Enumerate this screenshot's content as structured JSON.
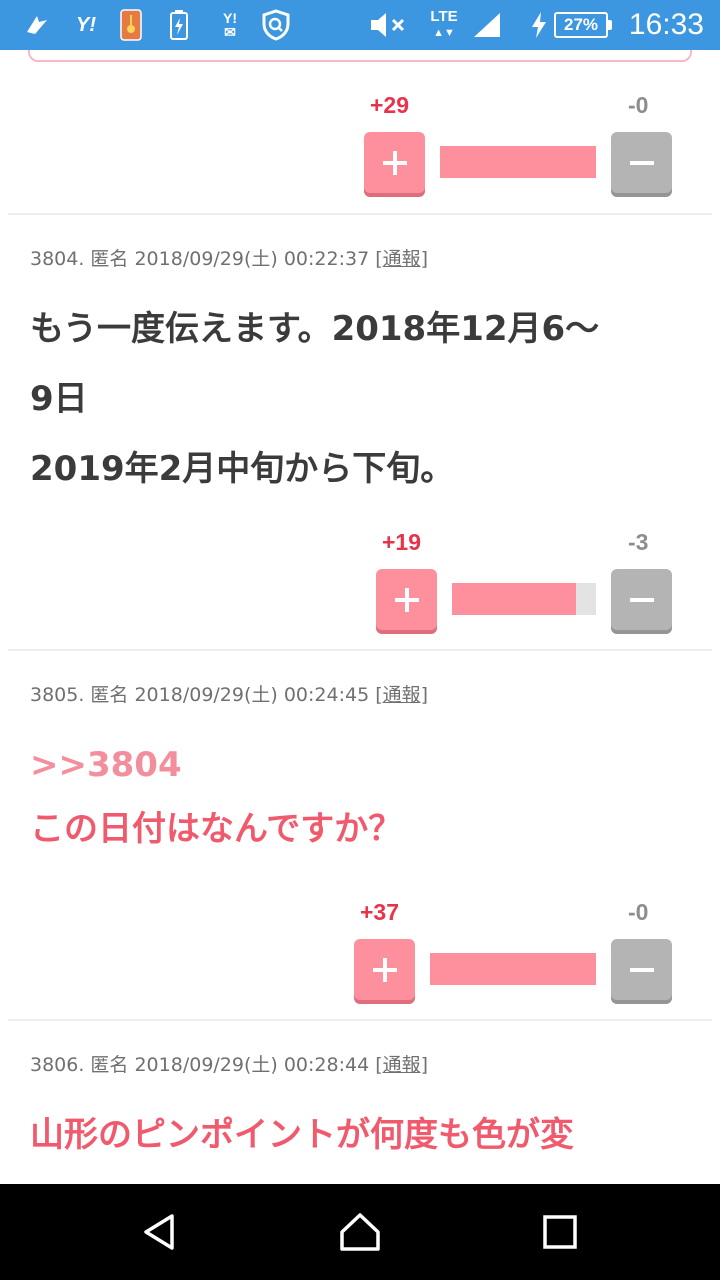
{
  "status_bar": {
    "time": "16:33",
    "battery": "27%",
    "network": "LTE",
    "icons": [
      "notification-icon",
      "yahoo-icon",
      "app-icon",
      "battery-saver-icon",
      "yahoo-mail-icon",
      "security-shield-icon",
      "mute-icon",
      "lte-icon",
      "signal-icon",
      "charging-icon",
      "battery-icon"
    ]
  },
  "comments": [
    {
      "number": "",
      "meta": "",
      "report": "",
      "text_lines": [],
      "votes": {
        "plus": "+29",
        "minus": "-0",
        "ratio": 1.0
      }
    },
    {
      "number": "3804.",
      "meta": "3804. 匿名 2018/09/29(土) 00:22:37",
      "report": "[通報]",
      "text_lines": [
        "もう一度伝えます。2018年12月6〜",
        "9日",
        "2019年2月中旬から下旬。"
      ],
      "votes": {
        "plus": "+19",
        "minus": "-3",
        "ratio": 0.86
      }
    },
    {
      "number": "3805.",
      "meta": "3805. 匿名 2018/09/29(土) 00:24:45",
      "report": "[通報]",
      "anchor": ">>3804",
      "text_lines": [
        "この日付はなんですか？"
      ],
      "votes": {
        "plus": "+37",
        "minus": "-0",
        "ratio": 1.0
      }
    },
    {
      "number": "3806.",
      "meta": "3806. 匿名 2018/09/29(土) 00:28:44",
      "report": "[通報]",
      "text_lines": [
        "山形のピンポイントが何度も色が変"
      ]
    }
  ],
  "colors": {
    "status_bar": "#3d96e0",
    "plus": "#fe8f9c",
    "plus_count": "#e8334a",
    "minus": "#b4b4b4",
    "pink_text": "#f05a6c",
    "anchor": "#f38e9d"
  },
  "nav": [
    "back-icon",
    "home-icon",
    "recents-icon"
  ]
}
